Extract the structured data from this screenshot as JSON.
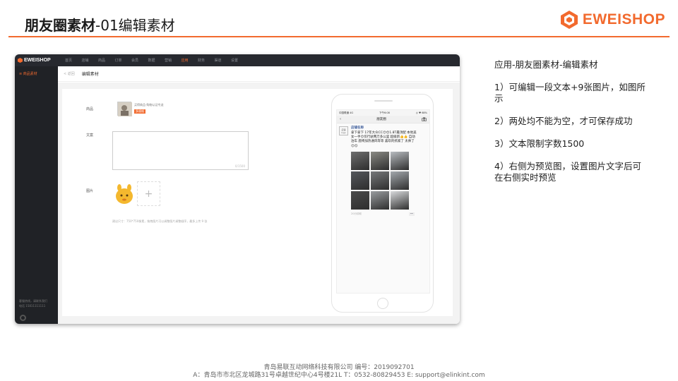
{
  "slide": {
    "title_bold": "朋友圈素材",
    "title_rest": "-01编辑素材",
    "brand": "EWEISHOP",
    "accent_color": "#f26a2e"
  },
  "app": {
    "logo": "EWEISHOP",
    "nav": [
      "首页",
      "店铺",
      "商品",
      "订单",
      "会员",
      "数据",
      "营销",
      "应用",
      "财务",
      "渠道",
      "设置"
    ],
    "active_nav": "应用",
    "sidebar_item": "商品素材",
    "sidebar_footer": [
      "客服热线，请联系我们",
      "电话 15811111111"
    ],
    "back_link": "< 返回",
    "page_title": "编辑素材",
    "form": {
      "goods_label": "商品",
      "goods_name": "买得商品-购物认证专送",
      "goods_tag": "多规格",
      "text_label": "文案",
      "text_counter": "0/1500",
      "image_label": "图片",
      "add_icon": "+",
      "hint": "建议尺寸：750*750像素，拖拽图片可以调整图片调整顺序，最多上传 9 张"
    }
  },
  "preview": {
    "status_left": "中国联通  4G",
    "status_time": "下午6:08",
    "status_right": "◎ ♥ 68%",
    "nav_back": "‹",
    "nav_title": "朋友圈",
    "nav_camera": "camera-icon",
    "avatar_line1": "店铺",
    "avatar_line2": "logo",
    "shop_name": "店铺名称",
    "post_text": "拿下拿下  17年大众CC😊😊1.8T最顶配  本地美女一手😊仅行驶两万多公里  超级新👍👍 自动泊车  座椅加热通风等等  喜欢的抓紧了  太帅了😊😊",
    "time": "20分钟前",
    "more": "••",
    "photo_colors": [
      "#6f6f6f",
      "#8a8a84",
      "#b8bcc0",
      "#54575c",
      "#76787a",
      "#a3a8ad",
      "#4a4a4a",
      "#999c9f",
      "#d8dadc"
    ]
  },
  "notes": [
    "应用-朋友圈素材-编辑素材",
    "1）可编辑一段文本+9张图片，如图所示",
    "2）两处均不能为空，才可保存成功",
    "3）文本限制字数1500",
    "4）右侧为预览图，设置图片文字后可在右侧实时预览"
  ],
  "footer": {
    "line1": "青岛易联互动网络科技有限公司    编号：2019092701",
    "line2": "A：青岛市市北区龙城路31号卓越世纪中心4号楼21L    T：0532-80829453    E: support@elinkint.com"
  }
}
